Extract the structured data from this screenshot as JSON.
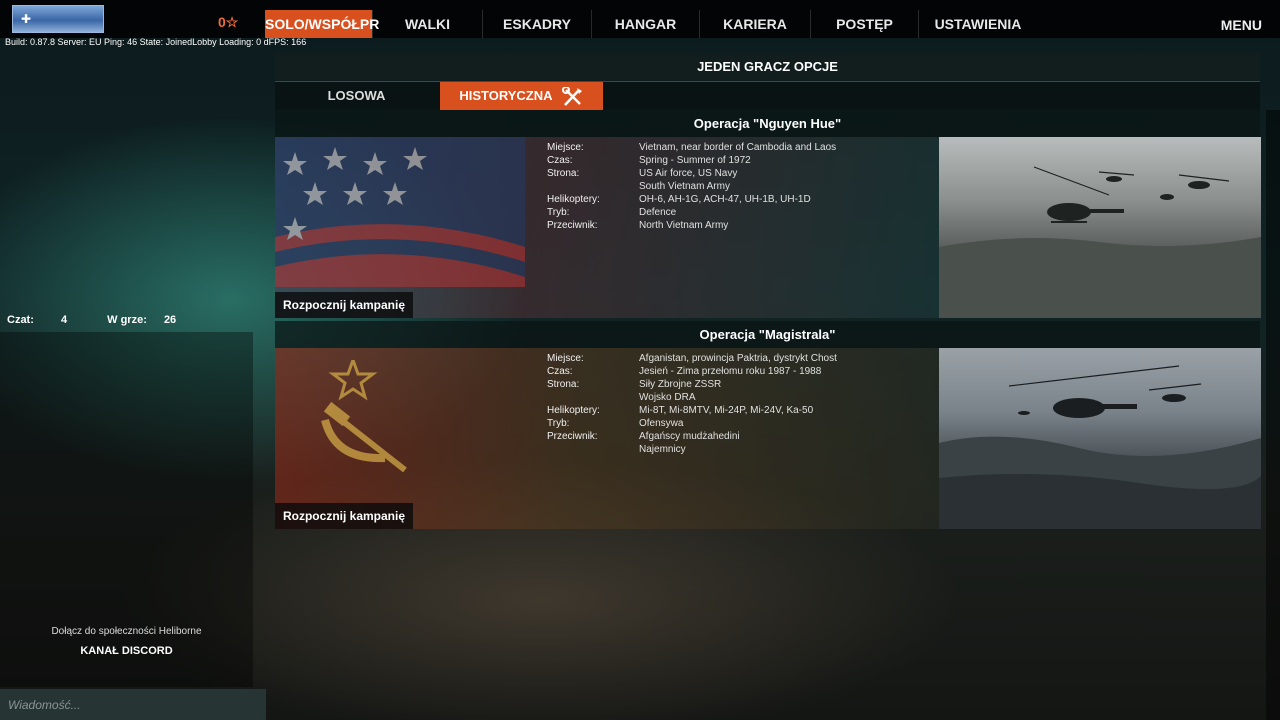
{
  "topbar": {
    "currency": "0☆",
    "nav": [
      {
        "label": "SOLO/WSPÓŁPR",
        "active": true
      },
      {
        "label": "WALKI",
        "active": false
      },
      {
        "label": "ESKADRY",
        "active": false
      },
      {
        "label": "HANGAR",
        "active": false
      },
      {
        "label": "KARIERA",
        "active": false
      },
      {
        "label": "POSTĘP",
        "active": false
      },
      {
        "label": "USTAWIENIA",
        "active": false
      }
    ],
    "menu_label": "MENU",
    "build_info": "Build: 0.87.8 Server: EU Ping: 46 State: JoinedLobby Loading: 0 dFPS: 166"
  },
  "chat": {
    "chat_label": "Czat:",
    "chat_count": "4",
    "ingame_label": "W grze:",
    "ingame_count": "26",
    "community_text": "Dołącz do społeczności Heliborne",
    "discord_label": "KANAŁ DISCORD",
    "message_placeholder": "Wiadomość..."
  },
  "main": {
    "title": "JEDEN GRACZ OPCJE",
    "tabs": [
      {
        "label": "LOSOWA",
        "active": false
      },
      {
        "label": "HISTORYCZNA",
        "active": true
      }
    ],
    "operations": [
      {
        "title": "Operacja \"Nguyen Hue\"",
        "rows": [
          {
            "label": "Miejsce:",
            "value": "Vietnam, near border of Cambodia and Laos"
          },
          {
            "label": "Czas:",
            "value": "Spring - Summer of 1972"
          },
          {
            "label": "Strona:",
            "value": "US Air force, US Navy"
          },
          {
            "label": "",
            "value": "South Vietnam Army"
          },
          {
            "label": "Helikoptery:",
            "value": "OH-6, AH-1G, ACH-47, UH-1B, UH-1D"
          },
          {
            "label": "Tryb:",
            "value": "Defence"
          },
          {
            "label": "Przeciwnik:",
            "value": "North Vietnam Army"
          }
        ],
        "start_label": "Rozpocznij kampanię"
      },
      {
        "title": "Operacja \"Magistrala\"",
        "rows": [
          {
            "label": "Miejsce:",
            "value": "Afganistan, prowincja Paktria, dystrykt Chost"
          },
          {
            "label": "Czas:",
            "value": "Jesień - Zima przełomu roku 1987 - 1988"
          },
          {
            "label": "Strona:",
            "value": "Siły Zbrojne ZSSR"
          },
          {
            "label": "",
            "value": "Wojsko DRA"
          },
          {
            "label": "Helikoptery:",
            "value": "Mi-8T, Mi-8MTV, Mi-24P, Mi-24V, Ka-50"
          },
          {
            "label": "Tryb:",
            "value": "Ofensywa"
          },
          {
            "label": "Przeciwnik:",
            "value": "Afgańscy mudżahedini"
          },
          {
            "label": "",
            "value": "Najemnicy"
          }
        ],
        "start_label": "Rozpocznij kampanię"
      }
    ]
  },
  "icons": {
    "flag": "player-flag-icon",
    "tools": "crossed-tools-icon",
    "star": "star-icon"
  },
  "colors": {
    "accent": "#d9501f",
    "currency": "#f06a3a"
  }
}
